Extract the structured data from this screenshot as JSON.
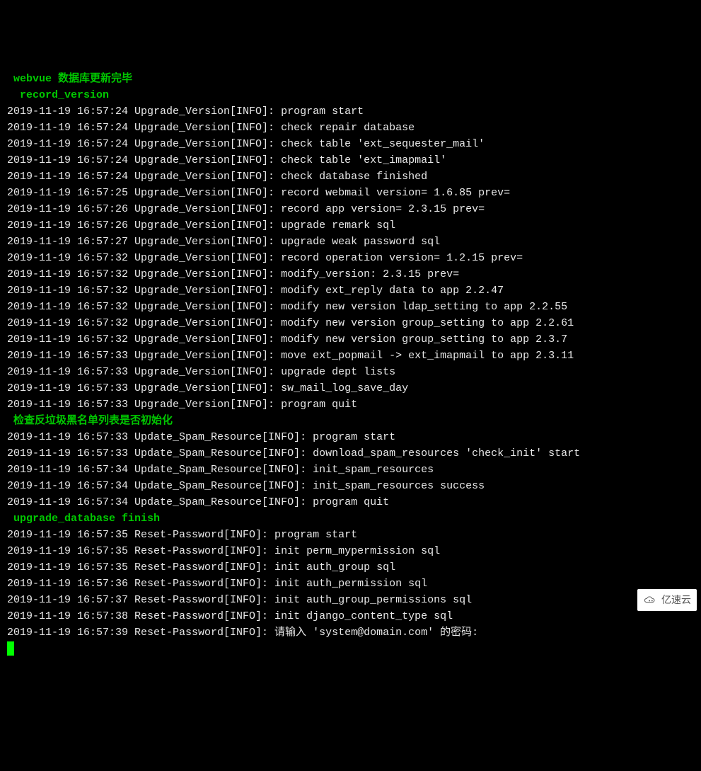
{
  "headers": {
    "h1": "webvue 数据库更新完毕",
    "h2": "record_version",
    "h3": "检查反垃圾黑名单列表是否初始化",
    "h4": "upgrade_database finish"
  },
  "upgrade_version_lines": [
    "2019-11-19 16:57:24 Upgrade_Version[INFO]: program start",
    "2019-11-19 16:57:24 Upgrade_Version[INFO]: check repair database",
    "2019-11-19 16:57:24 Upgrade_Version[INFO]: check table 'ext_sequester_mail'",
    "2019-11-19 16:57:24 Upgrade_Version[INFO]: check table 'ext_imapmail'",
    "2019-11-19 16:57:24 Upgrade_Version[INFO]: check database finished",
    "2019-11-19 16:57:25 Upgrade_Version[INFO]: record webmail version= 1.6.85 prev=",
    "2019-11-19 16:57:26 Upgrade_Version[INFO]: record app version= 2.3.15 prev=",
    "2019-11-19 16:57:26 Upgrade_Version[INFO]: upgrade remark sql",
    "2019-11-19 16:57:27 Upgrade_Version[INFO]: upgrade weak password sql",
    "2019-11-19 16:57:32 Upgrade_Version[INFO]: record operation version= 1.2.15 prev=",
    "2019-11-19 16:57:32 Upgrade_Version[INFO]: modify_version: 2.3.15 prev=",
    "2019-11-19 16:57:32 Upgrade_Version[INFO]: modify ext_reply data to app 2.2.47",
    "2019-11-19 16:57:32 Upgrade_Version[INFO]: modify new version ldap_setting to app 2.2.55",
    "2019-11-19 16:57:32 Upgrade_Version[INFO]: modify new version group_setting to app 2.2.61",
    "2019-11-19 16:57:32 Upgrade_Version[INFO]: modify new version group_setting to app 2.3.7",
    "2019-11-19 16:57:33 Upgrade_Version[INFO]: move ext_popmail -> ext_imapmail to app 2.3.11",
    "2019-11-19 16:57:33 Upgrade_Version[INFO]: upgrade dept lists",
    "2019-11-19 16:57:33 Upgrade_Version[INFO]: sw_mail_log_save_day",
    "2019-11-19 16:57:33 Upgrade_Version[INFO]: program quit"
  ],
  "spam_lines": [
    "2019-11-19 16:57:33 Update_Spam_Resource[INFO]: program start",
    "2019-11-19 16:57:33 Update_Spam_Resource[INFO]: download_spam_resources 'check_init' start",
    "2019-11-19 16:57:34 Update_Spam_Resource[INFO]: init_spam_resources",
    "2019-11-19 16:57:34 Update_Spam_Resource[INFO]: init_spam_resources success",
    "2019-11-19 16:57:34 Update_Spam_Resource[INFO]: program quit"
  ],
  "reset_lines": [
    "2019-11-19 16:57:35 Reset-Password[INFO]: program start",
    "2019-11-19 16:57:35 Reset-Password[INFO]: init perm_mypermission sql",
    "2019-11-19 16:57:35 Reset-Password[INFO]: init auth_group sql",
    "2019-11-19 16:57:36 Reset-Password[INFO]: init auth_permission sql",
    "2019-11-19 16:57:37 Reset-Password[INFO]: init auth_group_permissions sql",
    "2019-11-19 16:57:38 Reset-Password[INFO]: init django_content_type sql",
    "2019-11-19 16:57:39 Reset-Password[INFO]: 请输入 'system@domain.com' 的密码:"
  ],
  "watermark": "亿速云"
}
